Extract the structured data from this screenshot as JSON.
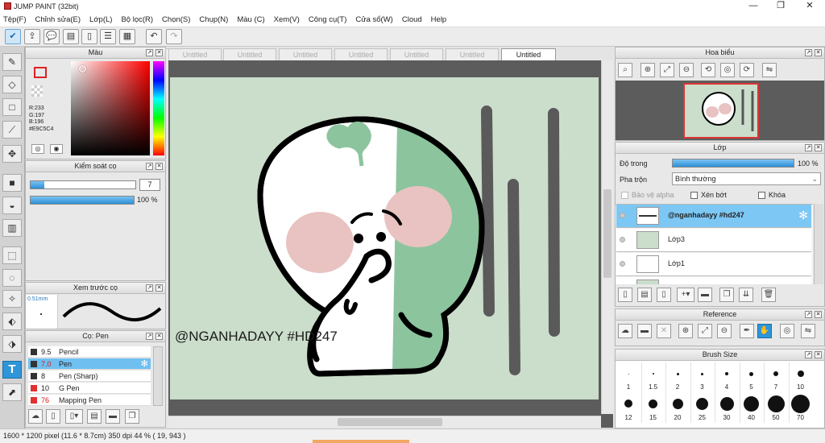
{
  "window": {
    "title": "JUMP PAINT (32bit)",
    "minimize": "—",
    "restore": "❐",
    "close": "✕"
  },
  "menu": [
    "Tệp(F)",
    "Chỉnh sửa(E)",
    "Lớp(L)",
    "Bộ lọc(R)",
    "Chọn(S)",
    "Chụp(N)",
    "Màu (C)",
    "Xem(V)",
    "Công cụ(T)",
    "Cửa sổ(W)",
    "Cloud",
    "Help"
  ],
  "tabs": [
    "Untitled",
    "Untitled",
    "Untitled",
    "Untitled",
    "Untitled",
    "Untitled",
    "Untitled"
  ],
  "color_panel": {
    "title": "Màu",
    "r": "R:233",
    "g": "G:197",
    "b": "B:196",
    "hex": "#E9C5C4",
    "fg": "#e9c5c4"
  },
  "brush_control": {
    "title": "Kiểm soát cọ",
    "size": "7",
    "opacity": "100 %",
    "size_level": 0.13,
    "opacity_level": 1.0
  },
  "brush_preview": {
    "title": "Xem trước cọ",
    "size_label": "0.51mm"
  },
  "brushes": {
    "title": "Cọ: Pen",
    "items": [
      {
        "size": "9.5",
        "name": "Pencil",
        "color": "#333333"
      },
      {
        "size": "7.0",
        "name": "Pen",
        "color": "#333333"
      },
      {
        "size": "8",
        "name": "Pen (Sharp)",
        "color": "#333333"
      },
      {
        "size": "10",
        "name": "G Pen",
        "color": "#e03030"
      },
      {
        "size": "76",
        "name": "Mapping Pen",
        "color": "#e03030"
      }
    ]
  },
  "canvas": {
    "watermark": "@NGANHADAYY #HD247",
    "bg": "#cbddcb"
  },
  "navigator": {
    "title": "Hoa biểu"
  },
  "layers": {
    "title": "Lớp",
    "opacity_label": "Độ trong",
    "opacity_value": "100 %",
    "blend_label": "Pha trộn",
    "blend_value": "Bình thường",
    "protect_alpha": "Bảo vệ alpha",
    "clipping": "Xén bớt",
    "lock": "Khóa",
    "items": [
      {
        "name": "@nganhadayy #hd247"
      },
      {
        "name": "Lớp3"
      },
      {
        "name": "Lớp1"
      }
    ]
  },
  "reference": {
    "title": "Reference"
  },
  "brush_size": {
    "title": "Brush Size",
    "row1": [
      "1",
      "1.5",
      "2",
      "3",
      "4",
      "5",
      "7",
      "10"
    ],
    "row2": [
      "12",
      "15",
      "20",
      "25",
      "30",
      "40",
      "50",
      "70"
    ]
  },
  "status": {
    "text": "1600 * 1200 pixel   (11.6 * 8.7cm)   350 dpi   44 %   ( 19, 943 )"
  }
}
